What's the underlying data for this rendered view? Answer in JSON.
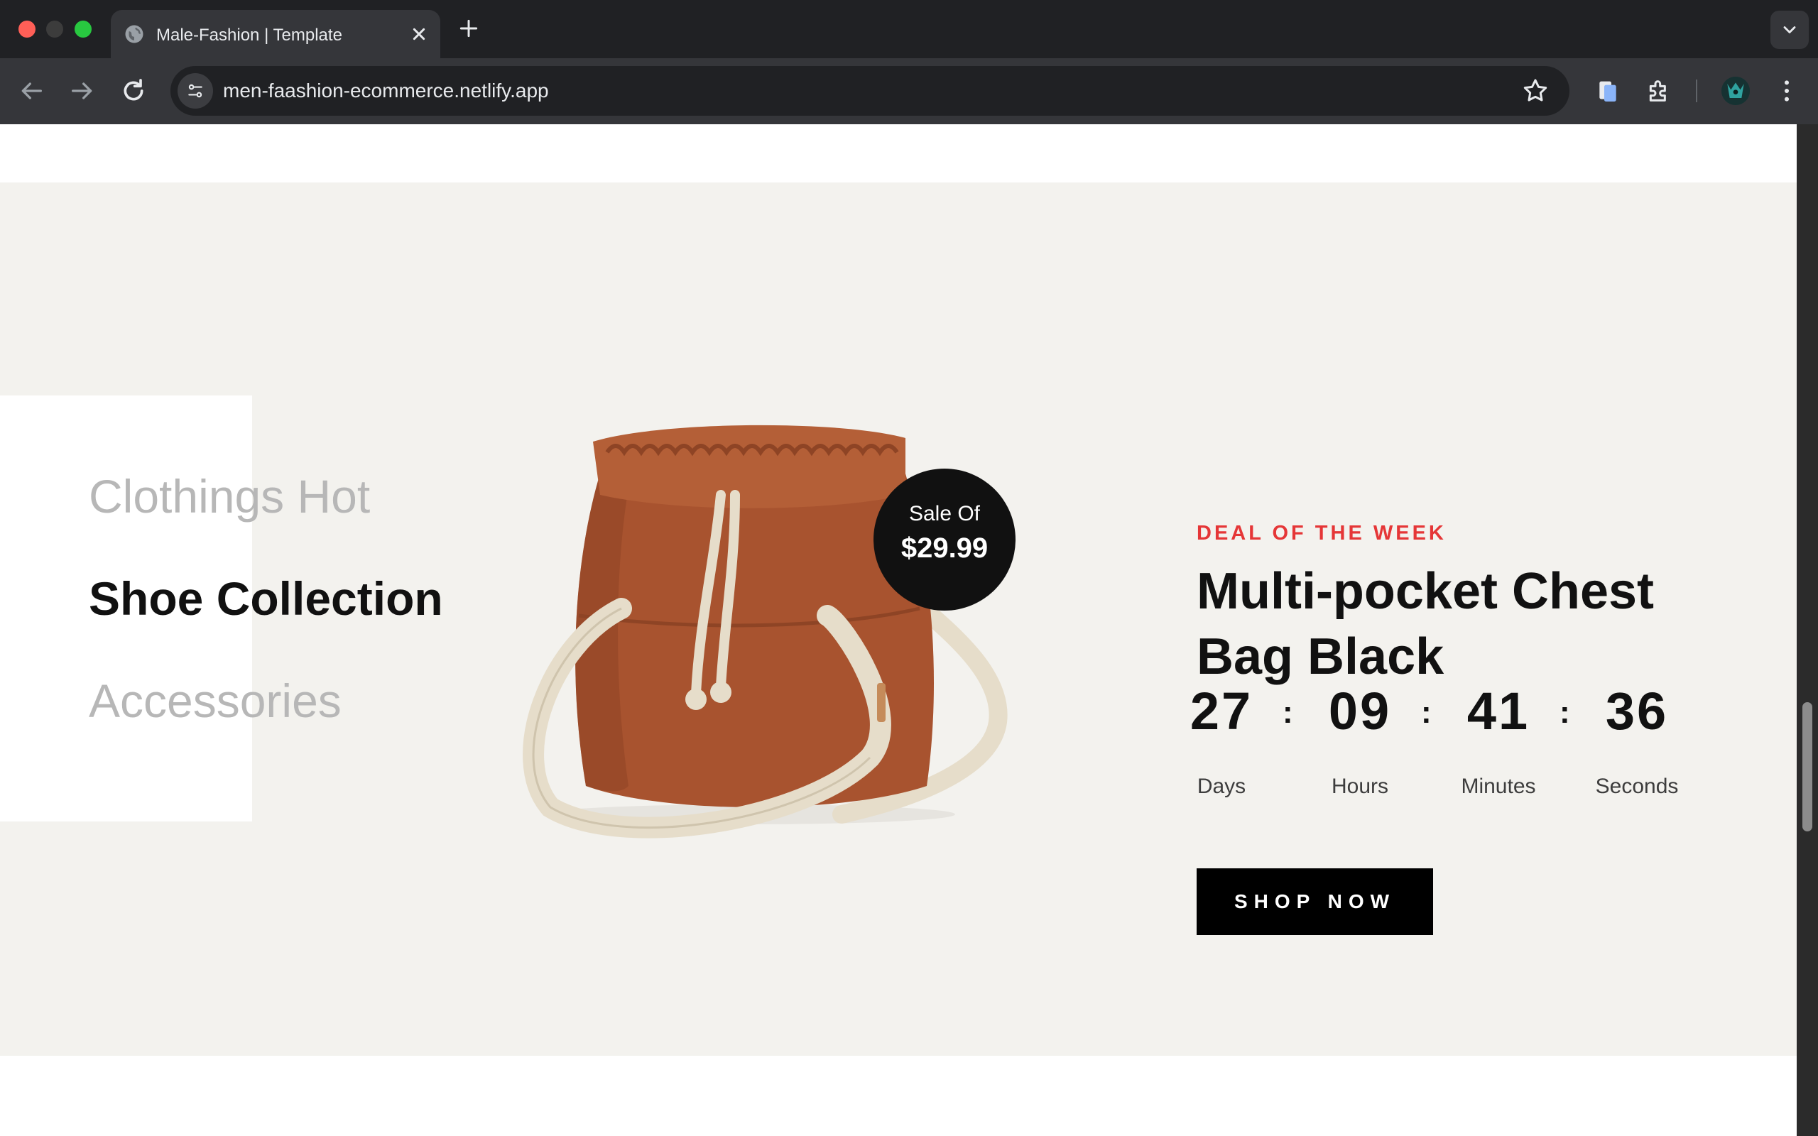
{
  "browser": {
    "tab_title": "Male-Fashion | Template",
    "url": "men-faashion-ecommerce.netlify.app",
    "icons": [
      "globe-icon",
      "close-icon",
      "plus-icon",
      "chevron-down-icon",
      "back-arrow-icon",
      "forward-arrow-icon",
      "reload-icon",
      "tune-icon",
      "star-icon",
      "clipboard-icon",
      "puzzle-icon",
      "kebab-menu-icon"
    ]
  },
  "categories": {
    "items": [
      "Clothings Hot",
      "Shoe Collection",
      "Accessories"
    ],
    "active_index": 1
  },
  "product": {
    "sale_label": "Sale Of",
    "sale_price": "$29.99"
  },
  "deal": {
    "label": "DEAL OF THE WEEK",
    "title": "Multi-pocket Chest Bag Black",
    "countdown": [
      {
        "value": "27",
        "unit": "Days"
      },
      {
        "value": "09",
        "unit": "Hours"
      },
      {
        "value": "41",
        "unit": "Minutes"
      },
      {
        "value": "36",
        "unit": "Seconds"
      }
    ],
    "separator": ":",
    "button_label": "SHOP NOW"
  },
  "colors": {
    "accent_red": "#e53637",
    "deal_background": "#f3f2ee",
    "text_dark": "#111111",
    "text_muted": "#b7b7b7",
    "bag_brown": "#a8532f",
    "strap_cream": "#e6ddca"
  }
}
